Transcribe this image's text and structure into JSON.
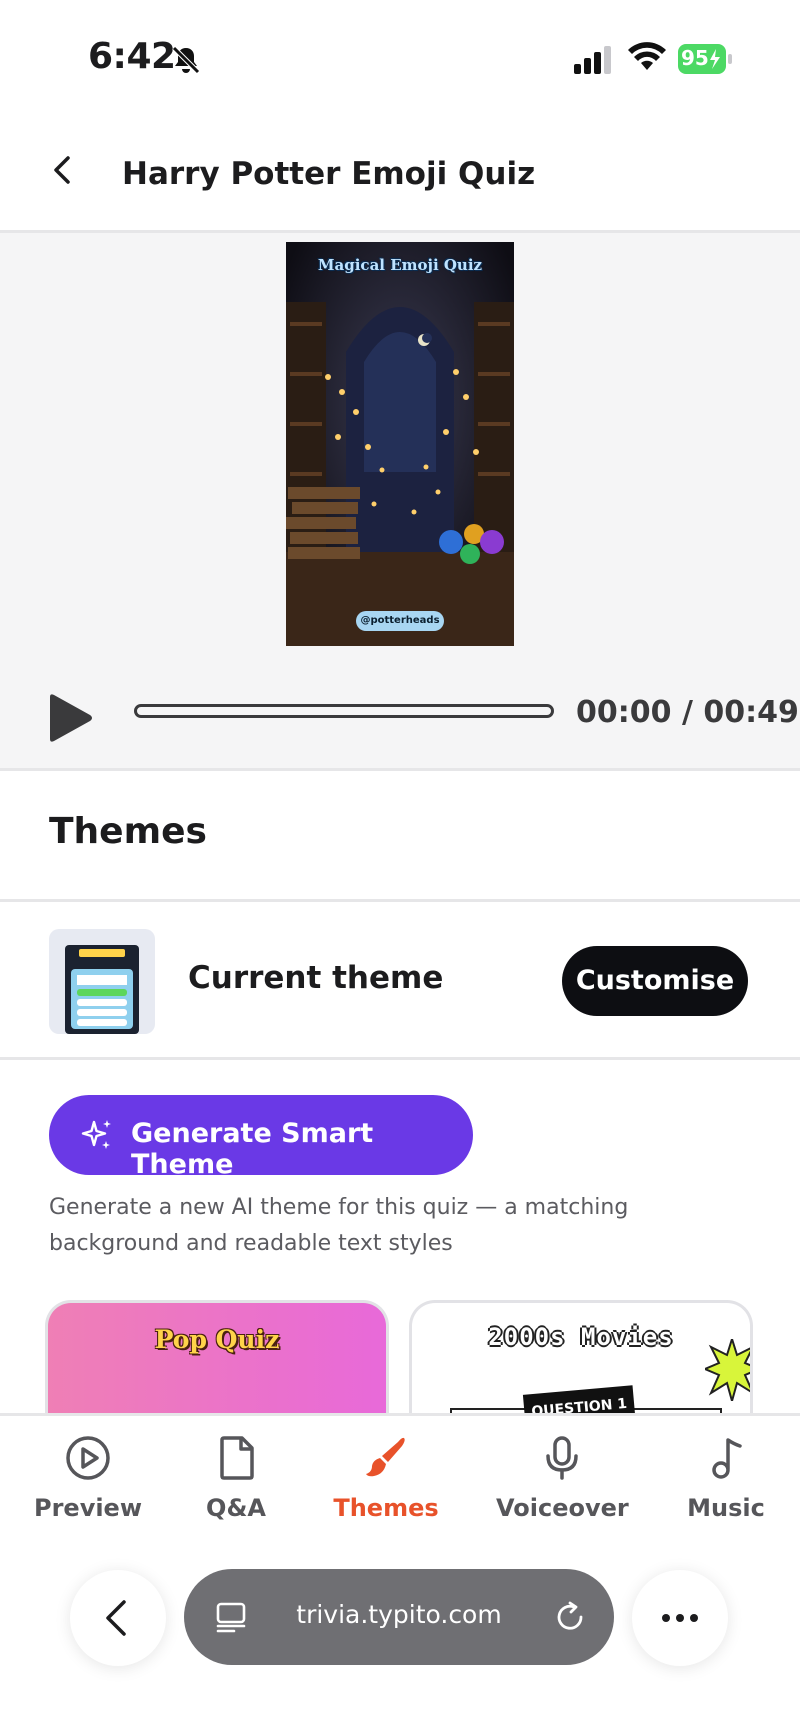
{
  "status_bar": {
    "time": "6:42",
    "battery": "95"
  },
  "header": {
    "title": "Harry Potter Emoji Quiz"
  },
  "preview": {
    "video_title": "Magical Emoji Quiz",
    "video_handle": "@potterheads",
    "time_readout": "00:00 / 00:49",
    "progress": 0.0
  },
  "themes": {
    "heading": "Themes",
    "current_theme_label": "Current theme",
    "customise_label": "Customise",
    "generate_label": "Generate Smart Theme",
    "generate_description": "Generate a new AI theme for this quiz — a matching background and readable text styles",
    "cards": [
      {
        "title": "Pop Quiz"
      },
      {
        "title": "2000s Movies",
        "tag": "QUESTION 1"
      }
    ]
  },
  "tabs": [
    {
      "label": "Preview",
      "icon": "play-circle-icon"
    },
    {
      "label": "Q&A",
      "icon": "document-icon"
    },
    {
      "label": "Themes",
      "icon": "paintbrush-icon",
      "active": true
    },
    {
      "label": "Voiceover",
      "icon": "microphone-icon"
    },
    {
      "label": "Music",
      "icon": "music-note-icon"
    }
  ],
  "browser": {
    "url": "trivia.typito.com"
  },
  "colors": {
    "accent_tab": "#e8522a",
    "generate_button": "#6a39e6",
    "customise_button": "#0d0e12",
    "battery_green": "#4cd964"
  }
}
